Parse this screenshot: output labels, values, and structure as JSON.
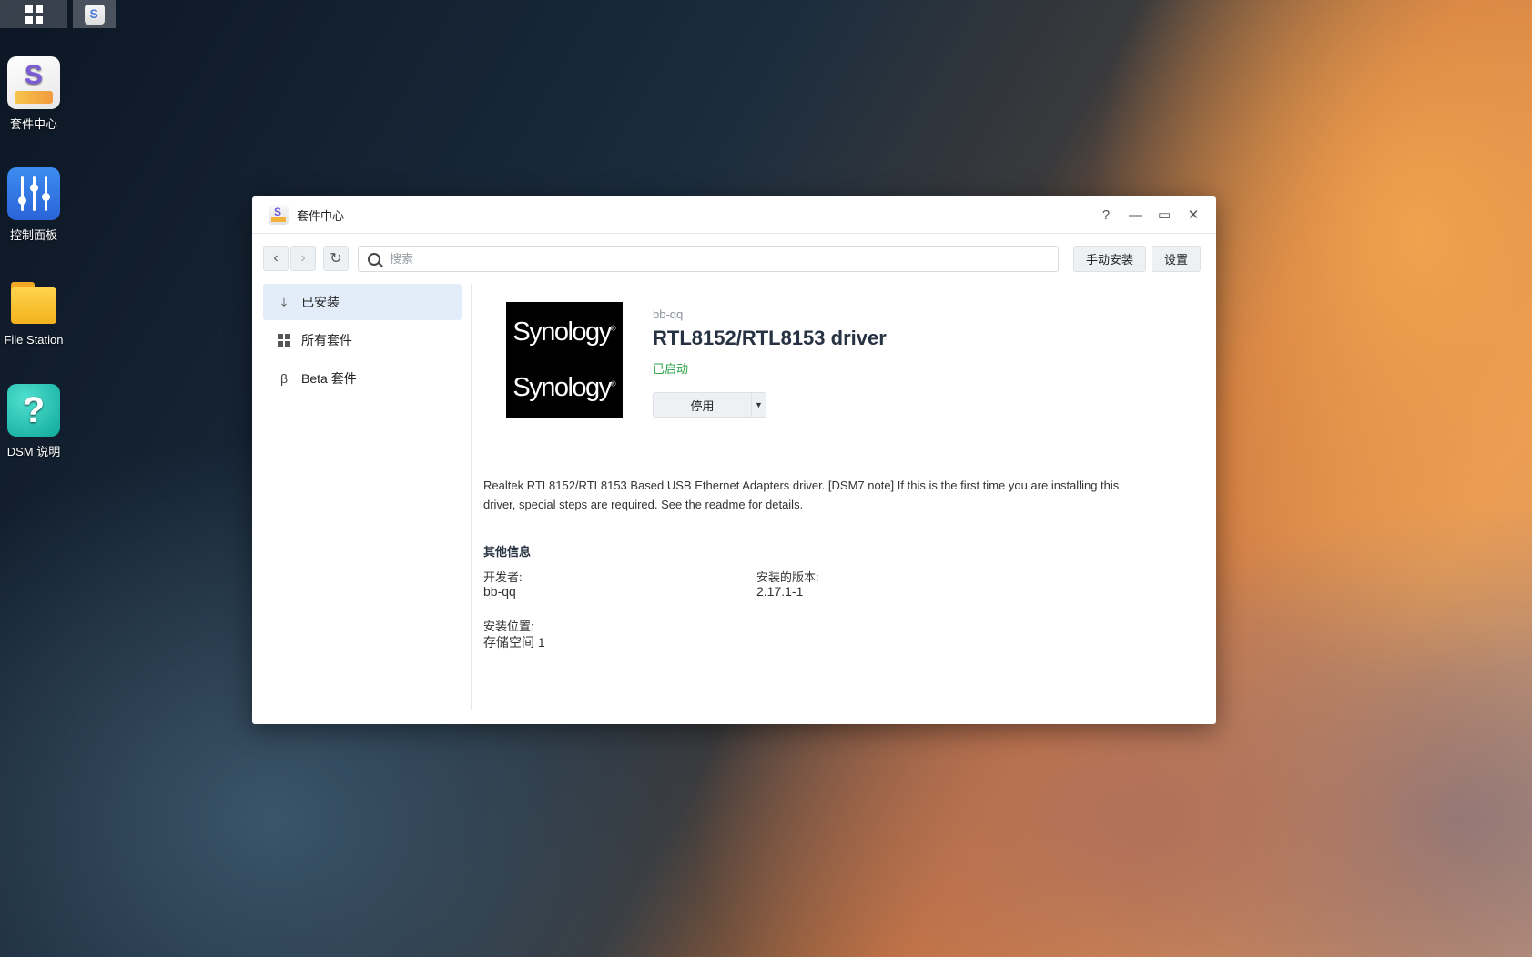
{
  "desktop": {
    "icons": [
      {
        "label": "套件中心"
      },
      {
        "label": "控制面板"
      },
      {
        "label": "File Station"
      },
      {
        "label": "DSM 说明"
      }
    ]
  },
  "window": {
    "title": "套件中心",
    "controls": {
      "help": "?",
      "minimize": "—",
      "maximize": "▭",
      "close": "✕"
    }
  },
  "toolbar": {
    "search_placeholder": "搜索",
    "manual_install": "手动安装",
    "settings": "设置"
  },
  "sidebar": {
    "items": [
      {
        "label": "已安装",
        "active": true
      },
      {
        "label": "所有套件",
        "active": false
      },
      {
        "label": "Beta 套件",
        "active": false
      }
    ]
  },
  "package": {
    "logo_text_1": "Synology",
    "logo_text_2": "Synology",
    "developer_top": "bb-qq",
    "name": "RTL8152/RTL8153 driver",
    "status": "已启动",
    "action_button": "停用",
    "description": "Realtek RTL8152/RTL8153 Based USB Ethernet Adapters driver. [DSM7 note] If this is the first time you are installing this driver, special steps are required. See the readme for details.",
    "info_title": "其他信息",
    "developer_label": "开发者:",
    "developer_value": "bb-qq",
    "version_label": "安装的版本:",
    "version_value": "2.17.1-1",
    "location_label": "安装位置:",
    "location_value": "存储空间 1"
  },
  "colors": {
    "status_green": "#2aa345",
    "active_nav_bg": "#e3edf9",
    "title_text": "#273242"
  }
}
